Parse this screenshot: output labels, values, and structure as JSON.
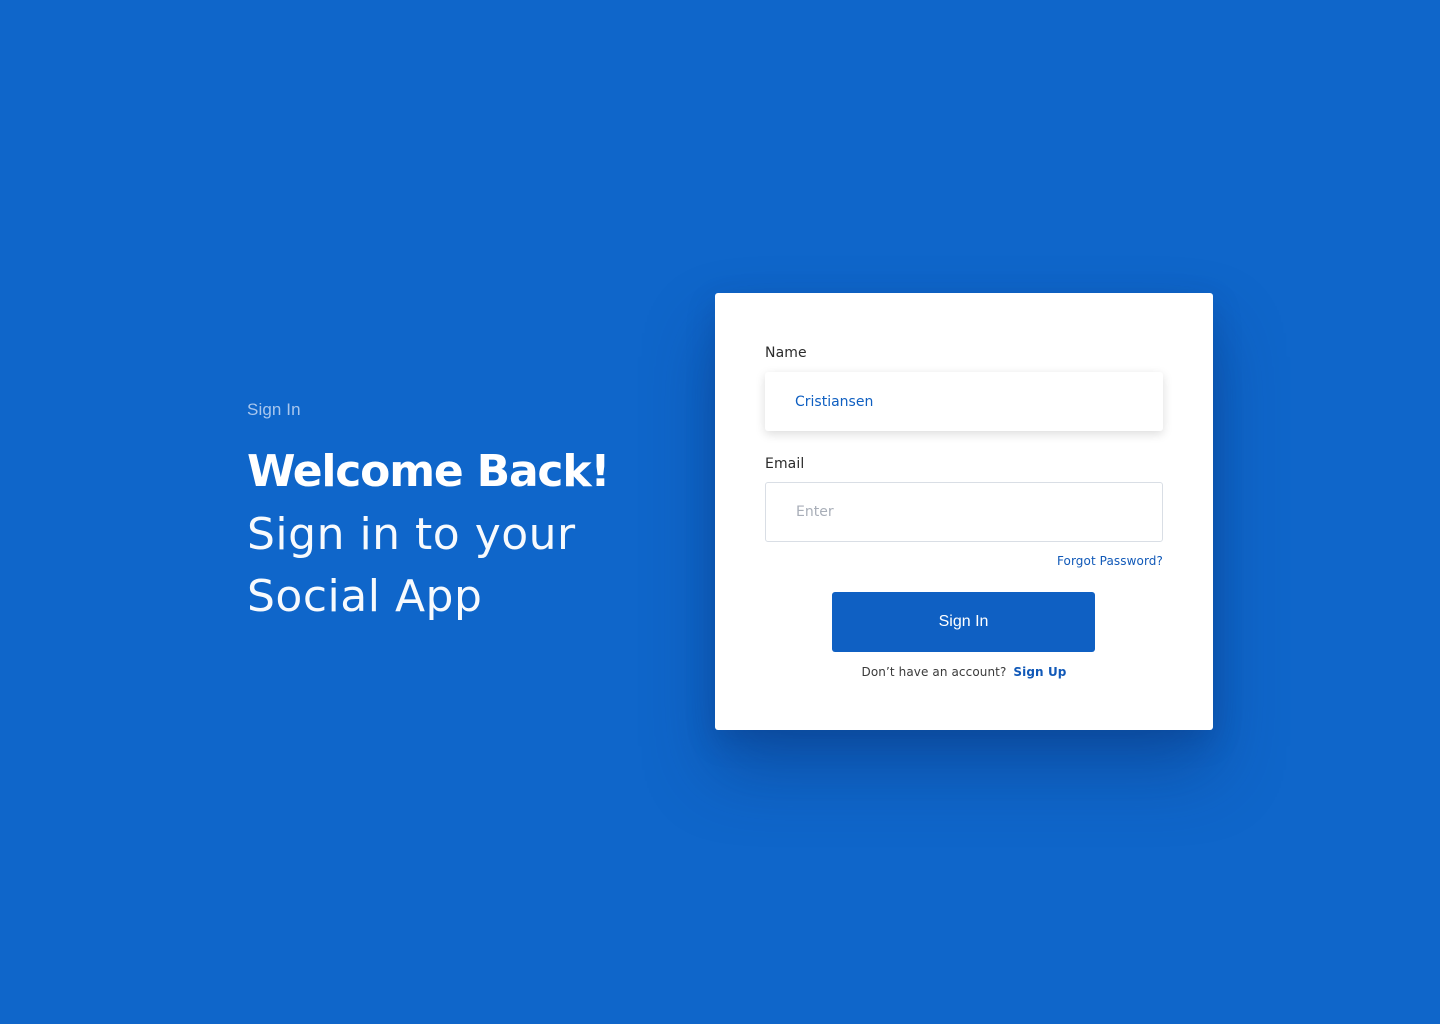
{
  "colors": {
    "background": "#0F66CA",
    "card": "#FFFFFF",
    "primary_button": "#0F60C3",
    "link": "#1159B8"
  },
  "hero": {
    "eyebrow": "Sign In",
    "title": "Welcome Back!",
    "subtitle_line1": "Sign in to your",
    "subtitle_line2": "Social App"
  },
  "form": {
    "name": {
      "label": "Name",
      "value": "Cristiansen"
    },
    "email": {
      "label": "Email",
      "value": "",
      "placeholder": "Enter"
    },
    "forgot_password": "Forgot Password?",
    "submit_label": "Sign In",
    "signup_prompt": "Don’t have an account?",
    "signup_link": "Sign Up"
  }
}
